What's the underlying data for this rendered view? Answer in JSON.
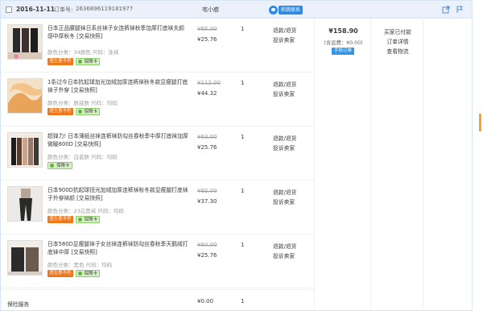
{
  "order": {
    "date": "2016-11-11",
    "order_no_label": "订单号:",
    "order_no": "2636896119181977",
    "seller": "宅小惑",
    "contact_label": "和我联系"
  },
  "items": [
    {
      "title": "日本正品腰腿袜日系丝袜子女连裤袜秋季加厚打底袜夫颜感中厚秋冬 [交易快照]",
      "attrs": "颜色分类：34颜色  尺码：连袜",
      "old_price": "¥65.00",
      "new_price": "¥25.76",
      "qty": "1",
      "links": [
        "退款/退货",
        "投诉卖家"
      ],
      "badges": [
        "违生意不符",
        "保障卡"
      ]
    },
    {
      "title": "1条过今日本抗起球加光加绒加厚连裤袜秋冬款显瘦腿打底袜子外穿 [交易快照]",
      "attrs": "颜色分类：肤底肤  尺码：均码",
      "old_price": "¥112.00",
      "new_price": "¥44.32",
      "qty": "1",
      "links": [
        "退款/退货",
        "投诉卖家"
      ],
      "badges": [
        "违生意不符",
        "保障卡"
      ]
    },
    {
      "title": "超弹力! 日本薄纸丝袜连裤袜防勾丝春秋季中厚打底袜加厚微暖600D [交易快照]",
      "attrs": "颜色分类：白蓝肤  尺码：均码",
      "old_price": "¥63.00",
      "new_price": "¥25.76",
      "qty": "1",
      "links": [
        "退款/退货",
        "投诉卖家"
      ],
      "badges": [
        "保障卡"
      ]
    },
    {
      "title": "日本900D抗起球扭光加绒加厚连裤袜秋冬款显瘦腿打底袜子外穿袜颜 [交易快照]",
      "attrs": "颜色分类：23白黑袜  尺码：均码",
      "old_price": "¥92.00",
      "new_price": "¥37.30",
      "qty": "1",
      "links": [
        "退款/退货",
        "投诉卖家"
      ],
      "badges": [
        "违生意不符",
        "保障卡"
      ]
    },
    {
      "title": "日本580D显瘦腿袜子女丝袜连裤袜防勾丝春秋季天鹅绒打底袜中厚 [交易快照]",
      "attrs": "颜色分类：黑色  尺码：均码",
      "old_price": "¥60.00",
      "new_price": "¥25.76",
      "qty": "1",
      "links": [
        "退款/退货",
        "投诉卖家"
      ],
      "badges": [
        "违生意不符",
        "保障卡"
      ]
    }
  ],
  "insurance": {
    "label": "保险服务",
    "price": "¥0.00",
    "qty": "1"
  },
  "summary": {
    "total": "¥158.90",
    "freight": "(含运费：¥0.00)",
    "pay_tag": "手机订单"
  },
  "status": {
    "lines": [
      "买家已付款",
      "订单详情",
      "查看物流"
    ]
  }
}
